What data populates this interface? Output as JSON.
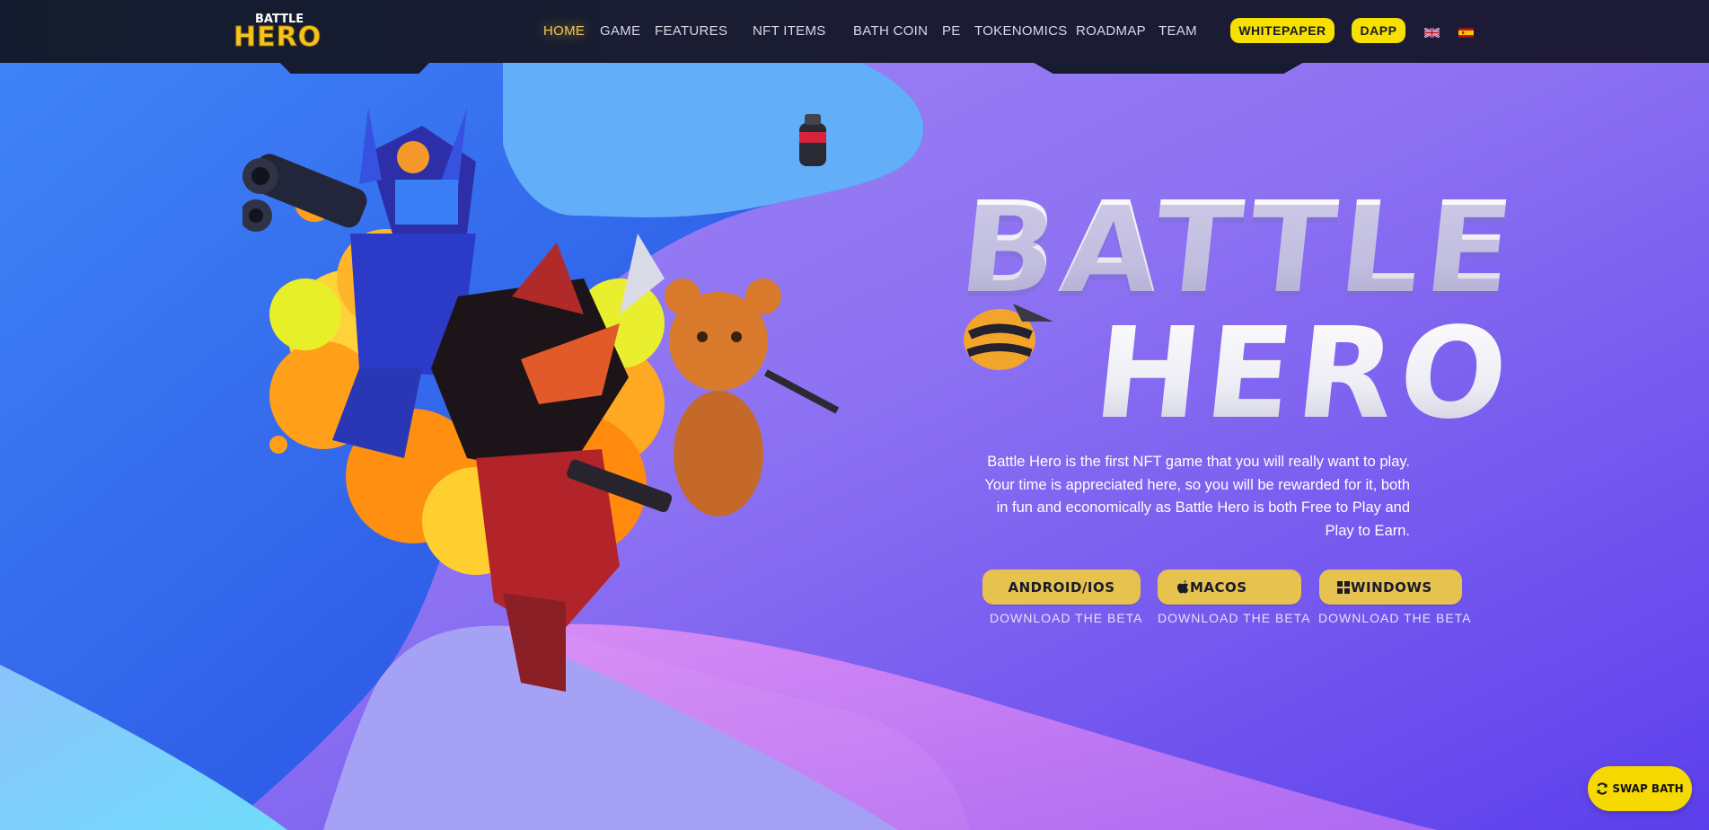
{
  "brand": {
    "logo_top": "BATTLE",
    "logo_bottom": "HERO",
    "accent": "#f2c84b",
    "button_yellow": "#f5e000"
  },
  "nav": {
    "items": [
      {
        "label": "HOME",
        "active": true
      },
      {
        "label": "GAME",
        "active": false
      },
      {
        "label": "FEATURES",
        "active": false
      },
      {
        "label": "NFT ITEMS",
        "active": false
      },
      {
        "label": "BATH COIN",
        "active": false
      },
      {
        "label": "PE",
        "active": false
      },
      {
        "label": "TOKENOMICS",
        "active": false
      },
      {
        "label": "ROADMAP",
        "active": false
      },
      {
        "label": "TEAM",
        "active": false
      }
    ],
    "whitepaper_label": "WHITEPAPER",
    "dapp_label": "DAPP",
    "languages": [
      {
        "code": "en",
        "icon": "uk-flag-icon"
      },
      {
        "code": "es",
        "icon": "spain-flag-icon"
      }
    ]
  },
  "hero": {
    "title_line1": "BATTLE",
    "title_line2": "HERO",
    "description": "Battle Hero is the first NFT game that you will really want to play. Your time is appreciated here, so you will be rewarded for it, both in fun and economically as Battle Hero is both Free to Play and Play to Earn.",
    "downloads": [
      {
        "label": "ANDROID/IOS",
        "icon": "",
        "caption": "DOWNLOAD THE BETA"
      },
      {
        "label": "MACOS",
        "icon": "apple-icon",
        "caption": "DOWNLOAD THE BETA"
      },
      {
        "label": "WINDOWS",
        "icon": "windows-icon",
        "caption": "DOWNLOAD THE BETA"
      }
    ]
  },
  "swap": {
    "label": "SWAP BATH",
    "icon": "refresh-icon"
  }
}
